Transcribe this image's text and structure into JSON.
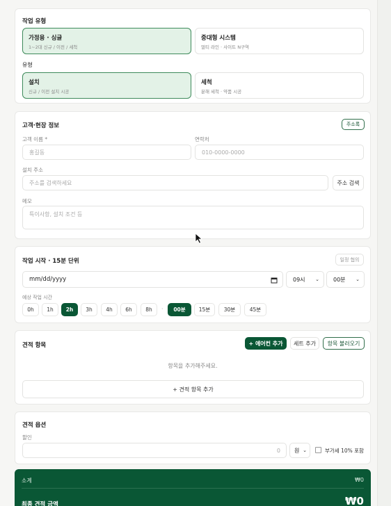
{
  "job_type": {
    "title": "작업 유형",
    "options": [
      {
        "title": "가정용 · 싱글",
        "sub": "1~2대 신규 / 이전 / 세척"
      },
      {
        "title": "중대형 시스템",
        "sub": "멀티 라인 · 사이트 N구역"
      }
    ]
  },
  "work_kind": {
    "title": "유형",
    "options": [
      {
        "title": "설치",
        "sub": "신규 / 이전 설치 시공"
      },
      {
        "title": "세척",
        "sub": "분해 세척 · 약품 시공"
      }
    ]
  },
  "customer": {
    "title": "고객·현장 정보",
    "address_book_label": "주소록",
    "name_label": "고객 이름 *",
    "name_placeholder": "홍길동",
    "phone_label": "연락처",
    "phone_placeholder": "010-0000-0000",
    "address_label": "설치 주소",
    "address_placeholder": "주소를 검색하세요",
    "address_search_label": "주소 검색",
    "memo_label": "메모",
    "memo_placeholder": "특이사항, 설치 조건 등"
  },
  "schedule": {
    "title": "작업 시작 · 15분 단위",
    "sync_label": "일정 협의",
    "date_placeholder": "mm/dd/yyyy",
    "hour_value": "09시",
    "minute_value": "00분",
    "duration_label": "예상 작업 시간",
    "hours": [
      "0h",
      "1h",
      "2h",
      "3h",
      "4h",
      "6h",
      "8h"
    ],
    "separator": "·",
    "minutes": [
      "00분",
      "15분",
      "30분",
      "45분"
    ]
  },
  "estimate_items": {
    "title": "견적 항목",
    "add_aircon_label": "+ 에어컨 추가",
    "add_set_label": "세트 추가",
    "load_items_label": "항목 불러오기",
    "empty_text": "항목을 추가해주세요.",
    "add_item_label": "+ 견적 항목 추가"
  },
  "estimate_options": {
    "title": "견적 옵션",
    "discount_label": "할인",
    "discount_value": "0",
    "unit_value": "원",
    "vat_label": "부가세 10% 포함"
  },
  "summary": {
    "subtotal_label": "소계",
    "subtotal_value": "₩0",
    "total_label": "최종 견적 금액",
    "total_value": "₩0"
  },
  "colors": {
    "accent": "#0a5735",
    "selected_bg": "#e3f2e7",
    "selected_border": "#3d8a5a"
  }
}
